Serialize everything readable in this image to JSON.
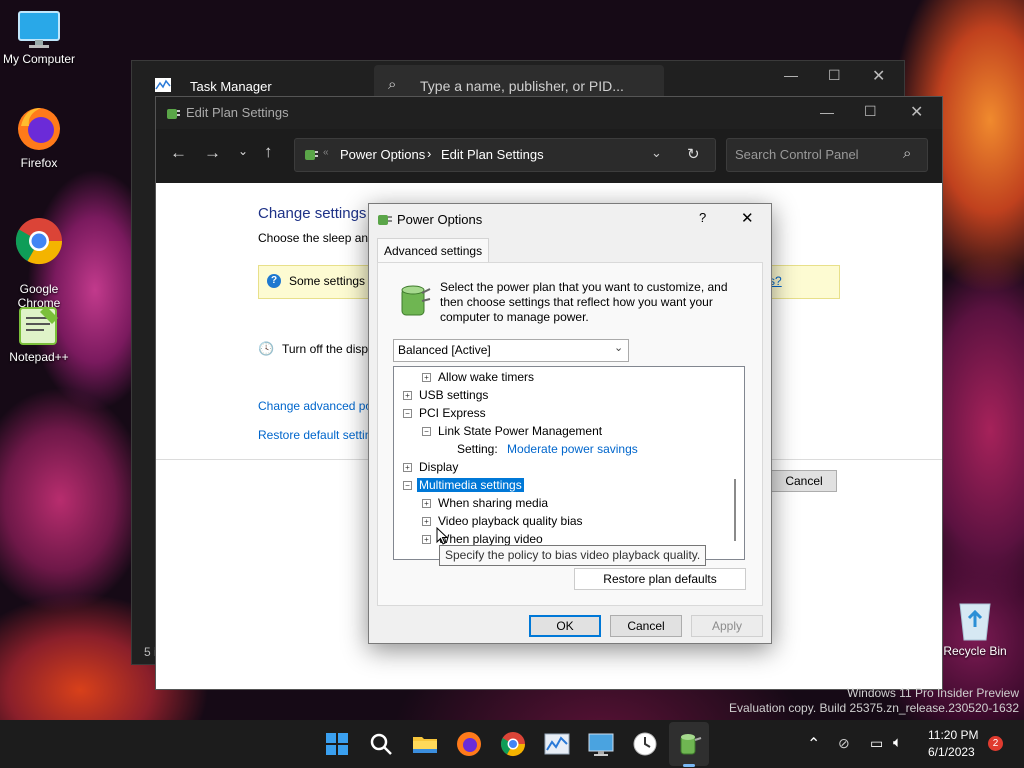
{
  "desktop": {
    "icons": [
      {
        "label": "My Computer",
        "icon": "monitor-icon"
      },
      {
        "label": "Firefox",
        "icon": "firefox-icon"
      },
      {
        "label": "Google\nChrome",
        "icon": "chrome-icon"
      },
      {
        "label": "Notepad++",
        "icon": "notepadpp-icon"
      },
      {
        "label": "Recycle Bin",
        "icon": "recycle-bin-icon"
      }
    ],
    "watermark_line1": "Windows 11 Pro Insider Preview",
    "watermark_line2": "Evaluation copy. Build 25375.zn_release.230520-1632"
  },
  "task_manager": {
    "title": "Task Manager",
    "search_placeholder": "Type a name, publisher, or PID...",
    "status_fragment": "5 i"
  },
  "edit_plan": {
    "title": "Edit Plan Settings",
    "breadcrumb": [
      "Power Options",
      "Edit Plan Settings"
    ],
    "search_placeholder": "Search Control Panel",
    "heading": "Change settings",
    "subtext": "Choose the sleep and",
    "info_text": "Some settings a",
    "info_link_fragment": "s?",
    "display_off_label": "Turn off the disp",
    "link_advanced": "Change advanced po",
    "link_restore": "Restore default settin",
    "cancel_label": "Cancel"
  },
  "dialog": {
    "title": "Power Options",
    "help": "?",
    "close": "✕",
    "tab": "Advanced settings",
    "description": "Select the power plan that you want to customize, and then choose settings that reflect how you want your computer to manage power.",
    "plan_selected": "Balanced [Active]",
    "tree": [
      {
        "indent": 1,
        "sign": "+",
        "label": "Allow wake timers"
      },
      {
        "indent": 0,
        "sign": "+",
        "label": "USB settings"
      },
      {
        "indent": 0,
        "sign": "-",
        "label": "PCI Express"
      },
      {
        "indent": 1,
        "sign": "-",
        "label": "Link State Power Management"
      },
      {
        "indent": 2,
        "sign": "",
        "label": "Setting:",
        "value": "Moderate power savings"
      },
      {
        "indent": 0,
        "sign": "+",
        "label": "Display"
      },
      {
        "indent": 0,
        "sign": "-",
        "label": "Multimedia settings",
        "selected": true
      },
      {
        "indent": 1,
        "sign": "+",
        "label": "When sharing media"
      },
      {
        "indent": 1,
        "sign": "+",
        "label": "Video playback quality bias"
      },
      {
        "indent": 1,
        "sign": "+",
        "label": "When playing video"
      }
    ],
    "tooltip": "Specify the policy to bias video playback quality.",
    "restore_button": "Restore plan defaults",
    "ok": "OK",
    "cancel": "Cancel",
    "apply": "Apply"
  },
  "taskbar": {
    "time": "11:20 PM",
    "date": "6/1/2023",
    "notification_count": "2",
    "apps": [
      "start-icon",
      "search-icon",
      "file-explorer-icon",
      "firefox-icon",
      "chrome-icon",
      "performance-monitor-icon",
      "remote-desktop-icon",
      "clock-icon",
      "power-options-icon"
    ]
  },
  "colors": {
    "accent": "#0078d7",
    "link": "#0066cc",
    "dark_chrome": "#202020"
  }
}
